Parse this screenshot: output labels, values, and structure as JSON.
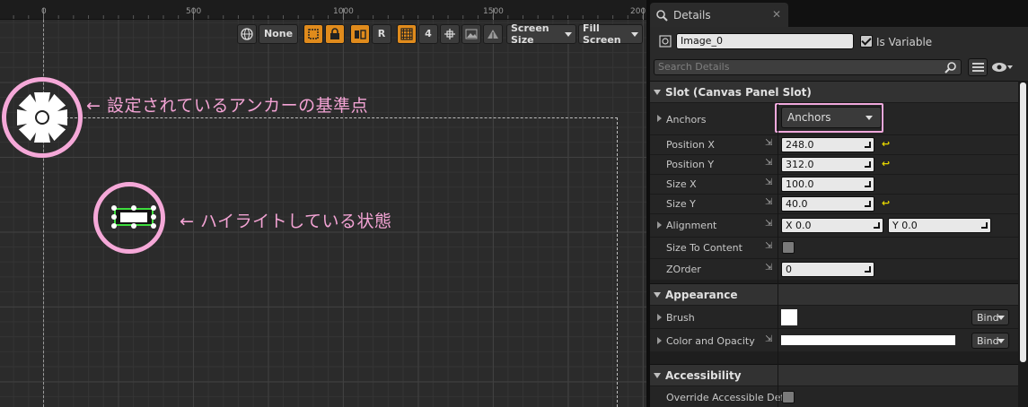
{
  "ruler": {
    "labels": [
      "0",
      "500",
      "1000",
      "1500",
      "200"
    ]
  },
  "toolbar": {
    "none_label": "None",
    "r_label": "R",
    "grid_value": "4",
    "screen_size_label": "Screen Size",
    "fill_screen_label": "Fill Screen"
  },
  "annotations": {
    "anchor_note": "← 設定されているアンカーの基準点",
    "highlight_note": "← ハイライトしている状態",
    "highlight_color": "#f5a8d8"
  },
  "details": {
    "tab_title": "Details",
    "widget_name": "Image_0",
    "is_variable_label": "Is Variable",
    "is_variable_checked": true,
    "search_placeholder": "Search Details",
    "sections": {
      "slot": "Slot (Canvas Panel Slot)",
      "appearance": "Appearance",
      "accessibility": "Accessibility"
    },
    "slot": {
      "anchors_label": "Anchors",
      "anchors_value": "Anchors",
      "position_x_label": "Position X",
      "position_x": "248.0",
      "position_y_label": "Position Y",
      "position_y": "312.0",
      "size_x_label": "Size X",
      "size_x": "100.0",
      "size_y_label": "Size Y",
      "size_y": "40.0",
      "alignment_label": "Alignment",
      "alignment_x": "X  0.0",
      "alignment_y": "Y  0.0",
      "size_to_content_label": "Size To Content",
      "zorder_label": "ZOrder",
      "zorder": "0"
    },
    "appearance": {
      "brush_label": "Brush",
      "color_label": "Color and Opacity",
      "bind_label": "Bind"
    },
    "accessibility": {
      "override_label": "Override Accessible Defa"
    }
  }
}
